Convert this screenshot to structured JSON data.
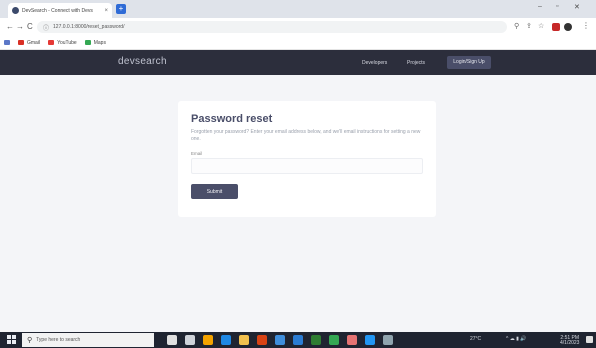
{
  "browser": {
    "tab_title": "DevSearch - Connect with Devs",
    "tab_close": "×",
    "new_tab": "+",
    "window_controls": {
      "minimize": "–",
      "maximize": "▫",
      "close": "✕"
    },
    "nav": {
      "back": "←",
      "forward": "→",
      "reload": "C"
    },
    "url": "127.0.0.1:8000/reset_password/",
    "bookmarks": [
      {
        "label": "Gmail",
        "color": "#d93025"
      },
      {
        "label": "YouTube",
        "color": "#e53935"
      },
      {
        "label": "Maps",
        "color": "#34a853"
      }
    ]
  },
  "site": {
    "logo": "devsearch",
    "nav": {
      "developers": "Developers",
      "projects": "Projects",
      "login": "Login/Sign Up"
    }
  },
  "reset_form": {
    "title": "Password reset",
    "description": "Forgotten your password? Enter your email address below, and we'll email instructions for setting a new one.",
    "email_label": "Email",
    "email_value": "",
    "submit_label": "Submit"
  },
  "taskbar": {
    "search_placeholder": "Type here to search",
    "apps": [
      {
        "icon": "circle-icon",
        "color": "#e0e0e0"
      },
      {
        "icon": "task-view-icon",
        "color": "#cfd3da"
      },
      {
        "icon": "browser-icon",
        "color": "#f4a300"
      },
      {
        "icon": "edge-icon",
        "color": "#1e88e5"
      },
      {
        "icon": "folder-icon",
        "color": "#f2c14e"
      },
      {
        "icon": "office-icon",
        "color": "#d84315"
      },
      {
        "icon": "store-icon",
        "color": "#3f8edc"
      },
      {
        "icon": "mail-icon",
        "color": "#2b7cd3"
      },
      {
        "icon": "terminal-icon",
        "color": "#2e7d32"
      },
      {
        "icon": "chrome-icon",
        "color": "#34a853"
      },
      {
        "icon": "app-icon",
        "color": "#e57373"
      },
      {
        "icon": "vscode-icon",
        "color": "#2196f3"
      },
      {
        "icon": "window-icon",
        "color": "#90a4ae"
      }
    ],
    "weather": "27°C",
    "tray": "^ ☁ ▮ 🔊",
    "time": "2:51 PM",
    "date": "4/1/2023"
  },
  "colors": {
    "nav_bg": "#2c2e3c",
    "accent": "#4a4e69",
    "page_bg": "#f4f5f8"
  }
}
